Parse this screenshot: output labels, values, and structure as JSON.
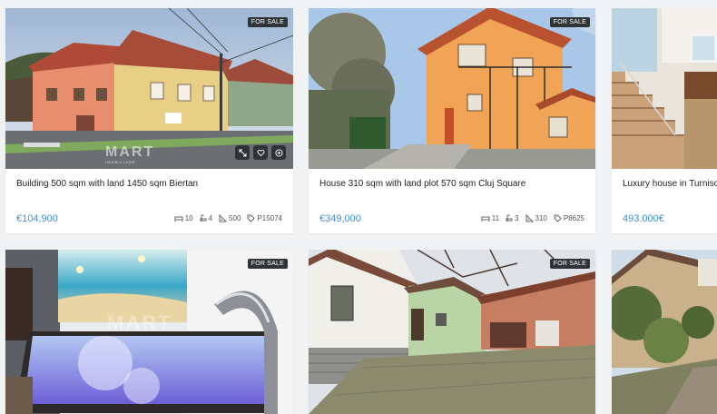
{
  "listings": [
    {
      "badge": "FOR SALE",
      "title": "Building 500 sqm with land 1450 sqm Biertan",
      "price": "€104,900",
      "rooms": "10",
      "baths": "4",
      "area": "500",
      "ref": "P15074",
      "watermark": "MART",
      "watermark_sub": "IMOBILIARE"
    },
    {
      "badge": "FOR SALE",
      "title": "House 310 sqm with land plot 570 sqm Cluj Square",
      "price": "€349,000",
      "rooms": "11",
      "baths": "3",
      "area": "310",
      "ref": "P8625"
    },
    {
      "title": "Luxury house in Turnisor",
      "price": "493.000€"
    },
    {
      "badge": "FOR SALE",
      "watermark": "MART"
    },
    {
      "badge": "FOR SALE"
    },
    {}
  ],
  "icons": {
    "expand": "expand-icon",
    "favorite": "heart-icon",
    "compare": "compare-icon",
    "rooms": "bed-icon",
    "baths": "bath-icon",
    "area": "area-icon",
    "ref": "tag-icon"
  },
  "colors": {
    "price": "#3f8ed6",
    "badge_bg": "#2f3437",
    "page_bg": "#f1f2f4"
  }
}
